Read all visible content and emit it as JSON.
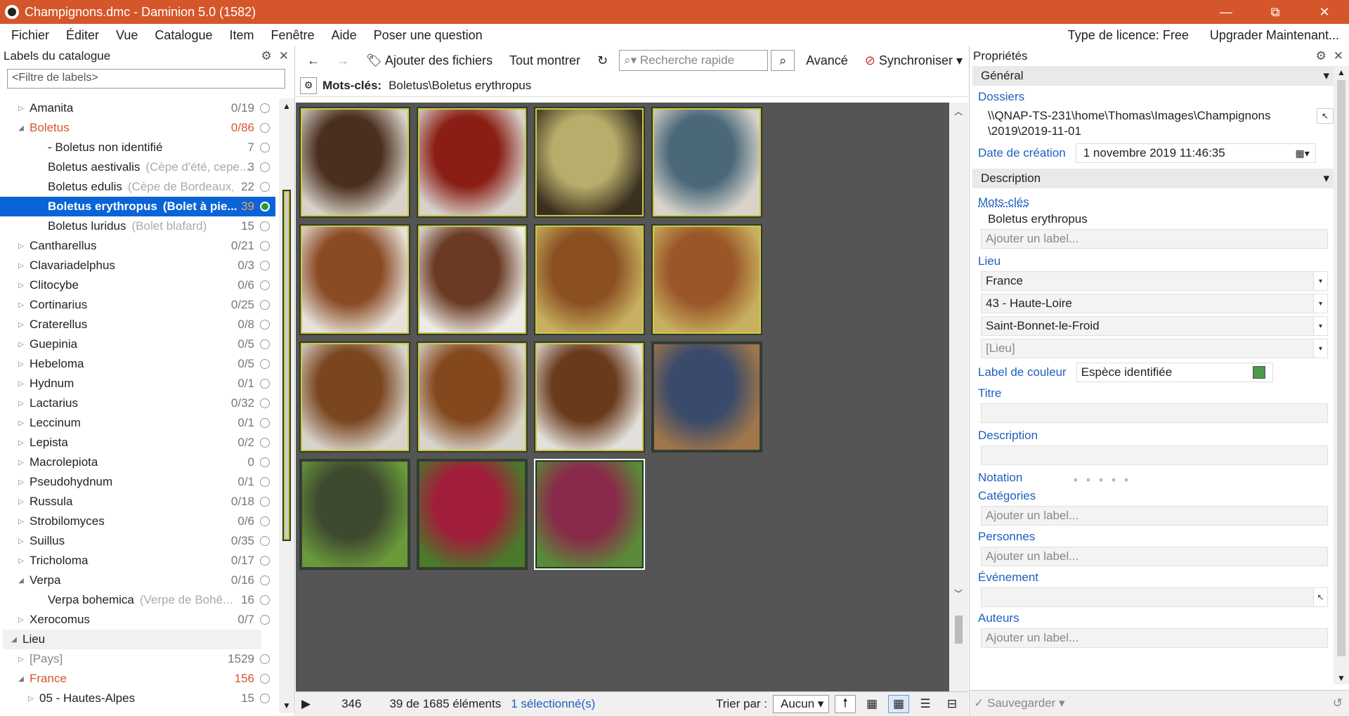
{
  "app": {
    "title": "Champignons.dmc - Daminion 5.0 (1582)"
  },
  "window_buttons": {
    "minimize": "—",
    "restore": "⧉",
    "close": "✕"
  },
  "menu": {
    "items": [
      "Fichier",
      "Éditer",
      "Vue",
      "Catalogue",
      "Item",
      "Fenêtre",
      "Aide",
      "Poser une question"
    ],
    "license": "Type de licence: Free",
    "upgrade": "Upgrader Maintenant..."
  },
  "left_panel": {
    "title": "Labels du catalogue",
    "filter_placeholder": "<Filtre de labels>",
    "tree": [
      {
        "indent": 1,
        "tri": "▷",
        "name": "Amanita",
        "alias": "",
        "count": "0/19",
        "style": ""
      },
      {
        "indent": 1,
        "tri": "◢",
        "name": "Boletus",
        "alias": "",
        "count": "0/86",
        "style": "orange"
      },
      {
        "indent": 2,
        "tri": "",
        "name": "- Boletus non identifié",
        "alias": "",
        "count": "7",
        "style": ""
      },
      {
        "indent": 2,
        "tri": "",
        "name": "Boletus aestivalis",
        "alias": "(Cèpe d'été, cepe...",
        "count": "3",
        "style": ""
      },
      {
        "indent": 2,
        "tri": "",
        "name": "Boletus edulis",
        "alias": "(Cèpe de Bordeaux,...",
        "count": "22",
        "style": ""
      },
      {
        "indent": 2,
        "tri": "",
        "name": "Boletus erythropus",
        "alias": "(Bolet à pie...",
        "count": "39",
        "style": "sel"
      },
      {
        "indent": 2,
        "tri": "",
        "name": "Boletus luridus",
        "alias": "(Bolet blafard)",
        "count": "15",
        "style": ""
      },
      {
        "indent": 1,
        "tri": "▷",
        "name": "Cantharellus",
        "alias": "",
        "count": "0/21",
        "style": ""
      },
      {
        "indent": 1,
        "tri": "▷",
        "name": "Clavariadelphus",
        "alias": "",
        "count": "0/3",
        "style": ""
      },
      {
        "indent": 1,
        "tri": "▷",
        "name": "Clitocybe",
        "alias": "",
        "count": "0/6",
        "style": ""
      },
      {
        "indent": 1,
        "tri": "▷",
        "name": "Cortinarius",
        "alias": "",
        "count": "0/25",
        "style": ""
      },
      {
        "indent": 1,
        "tri": "▷",
        "name": "Craterellus",
        "alias": "",
        "count": "0/8",
        "style": ""
      },
      {
        "indent": 1,
        "tri": "▷",
        "name": "Guepinia",
        "alias": "",
        "count": "0/5",
        "style": ""
      },
      {
        "indent": 1,
        "tri": "▷",
        "name": "Hebeloma",
        "alias": "",
        "count": "0/5",
        "style": ""
      },
      {
        "indent": 1,
        "tri": "▷",
        "name": "Hydnum",
        "alias": "",
        "count": "0/1",
        "style": ""
      },
      {
        "indent": 1,
        "tri": "▷",
        "name": "Lactarius",
        "alias": "",
        "count": "0/32",
        "style": ""
      },
      {
        "indent": 1,
        "tri": "▷",
        "name": "Leccinum",
        "alias": "",
        "count": "0/1",
        "style": ""
      },
      {
        "indent": 1,
        "tri": "▷",
        "name": "Lepista",
        "alias": "",
        "count": "0/2",
        "style": ""
      },
      {
        "indent": 1,
        "tri": "▷",
        "name": "Macrolepiota",
        "alias": "",
        "count": "0",
        "style": ""
      },
      {
        "indent": 1,
        "tri": "▷",
        "name": "Pseudohydnum",
        "alias": "",
        "count": "0/1",
        "style": ""
      },
      {
        "indent": 1,
        "tri": "▷",
        "name": "Russula",
        "alias": "",
        "count": "0/18",
        "style": ""
      },
      {
        "indent": 1,
        "tri": "▷",
        "name": "Strobilomyces",
        "alias": "",
        "count": "0/6",
        "style": ""
      },
      {
        "indent": 1,
        "tri": "▷",
        "name": "Suillus",
        "alias": "",
        "count": "0/35",
        "style": ""
      },
      {
        "indent": 1,
        "tri": "▷",
        "name": "Tricholoma",
        "alias": "",
        "count": "0/17",
        "style": ""
      },
      {
        "indent": 1,
        "tri": "◢",
        "name": "Verpa",
        "alias": "",
        "count": "0/16",
        "style": ""
      },
      {
        "indent": 2,
        "tri": "",
        "name": "Verpa bohemica",
        "alias": "(Verpe de Bohê...",
        "count": "16",
        "style": ""
      },
      {
        "indent": 1,
        "tri": "▷",
        "name": "Xerocomus",
        "alias": "",
        "count": "0/7",
        "style": ""
      },
      {
        "indent": 0,
        "tri": "◢",
        "name": "Lieu",
        "alias": "",
        "count": "",
        "style": "section"
      },
      {
        "indent": 1,
        "tri": "▷",
        "name": "[Pays]",
        "alias": "",
        "count": "1529",
        "style": "gray"
      },
      {
        "indent": 1,
        "tri": "◢",
        "name": "France",
        "alias": "",
        "count": "156",
        "style": "orange"
      },
      {
        "indent": 2,
        "tri": "▷",
        "name": "05 - Hautes-Alpes",
        "alias": "",
        "count": "15",
        "style": ""
      }
    ]
  },
  "toolbar": {
    "add_files": "Ajouter des fichiers",
    "show_all": "Tout montrer",
    "search_placeholder": "Recherche rapide",
    "advanced": "Avancé",
    "sync": "Synchroniser"
  },
  "keywords_bar": {
    "label": "Mots-clés:",
    "value": "Boletus\\Boletus erythropus"
  },
  "thumbnails": [
    {
      "c1": "#4a2f1e",
      "c2": "#d8d2c8",
      "frame": "yellow"
    },
    {
      "c1": "#8a1e14",
      "c2": "#d6d2cc",
      "frame": "yellow"
    },
    {
      "c1": "#b8ad6a",
      "c2": "#3a3020",
      "frame": "yellow"
    },
    {
      "c1": "#4a6878",
      "c2": "#d8d4cc",
      "frame": "yellow"
    },
    {
      "c1": "#8a4a24",
      "c2": "#e6e2da",
      "frame": "yellow"
    },
    {
      "c1": "#6a3a24",
      "c2": "#ecebe6",
      "frame": "yellow"
    },
    {
      "c1": "#8a5022",
      "c2": "#c8b060",
      "frame": "yellow"
    },
    {
      "c1": "#9a5628",
      "c2": "#c8b060",
      "frame": "yellow"
    },
    {
      "c1": "#7a4620",
      "c2": "#d8d4cc",
      "frame": "yellow"
    },
    {
      "c1": "#84481e",
      "c2": "#d8d4cc",
      "frame": "yellow"
    },
    {
      "c1": "#6a3a1c",
      "c2": "#e2e0da",
      "frame": "yellow"
    },
    {
      "c1": "#3a4a6a",
      "c2": "#a0764a",
      "frame": "none"
    },
    {
      "c1": "#3e4a30",
      "c2": "#6a9a3a",
      "frame": "none"
    },
    {
      "c1": "#a01e3a",
      "c2": "#4a7a2a",
      "frame": "none"
    },
    {
      "c1": "#8a2a4a",
      "c2": "#5a8a3a",
      "frame": "selected"
    }
  ],
  "status": {
    "page": "346",
    "count": "39 de 1685 éléments",
    "selected": "1 sélectionné(s)",
    "sort_label": "Trier par :",
    "sort_value": "Aucun"
  },
  "right_panel": {
    "title": "Propriétés",
    "general": "Général",
    "folders_label": "Dossiers",
    "folders_line1": "\\\\QNAP-TS-231\\home\\Thomas\\Images\\Champignons",
    "folders_line2": "\\2019\\2019-11-01",
    "created_label": "Date de création",
    "created_value": "1  novembre 2019   11:46:35",
    "description_section": "Description",
    "keywords_label": "Mots-clés",
    "keywords_value": "Boletus erythropus",
    "add_label": "Ajouter un label...",
    "place_label": "Lieu",
    "place_country": "France",
    "place_region": "43 - Haute-Loire",
    "place_city": "Saint-Bonnet-le-Froid",
    "place_empty": "[Lieu]",
    "color_label": "Label de couleur",
    "color_value": "Espèce identifiée",
    "color_swatch": "#4a9a4a",
    "title_label": "Titre",
    "desc_label": "Description",
    "rating_label": "Notation",
    "categories_label": "Catégories",
    "people_label": "Personnes",
    "event_label": "Événement",
    "authors_label": "Auteurs",
    "save": "Sauvegarder"
  }
}
